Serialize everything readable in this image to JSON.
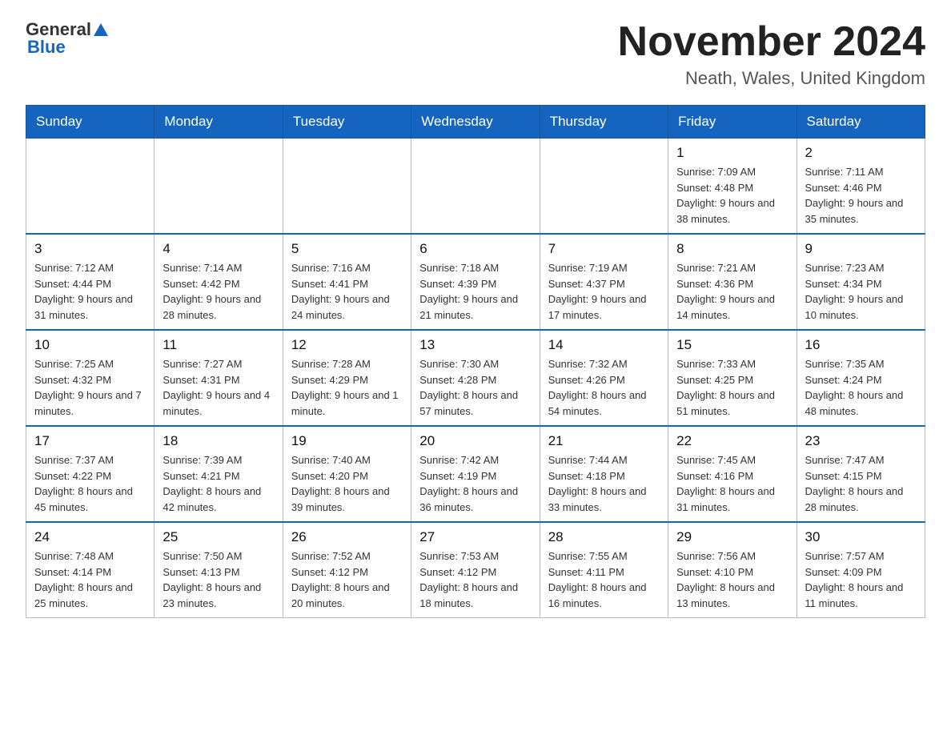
{
  "header": {
    "logo_general": "General",
    "logo_blue": "Blue",
    "month_title": "November 2024",
    "location": "Neath, Wales, United Kingdom"
  },
  "weekdays": [
    "Sunday",
    "Monday",
    "Tuesday",
    "Wednesday",
    "Thursday",
    "Friday",
    "Saturday"
  ],
  "weeks": [
    [
      {
        "day": "",
        "info": ""
      },
      {
        "day": "",
        "info": ""
      },
      {
        "day": "",
        "info": ""
      },
      {
        "day": "",
        "info": ""
      },
      {
        "day": "",
        "info": ""
      },
      {
        "day": "1",
        "info": "Sunrise: 7:09 AM\nSunset: 4:48 PM\nDaylight: 9 hours and 38 minutes."
      },
      {
        "day": "2",
        "info": "Sunrise: 7:11 AM\nSunset: 4:46 PM\nDaylight: 9 hours and 35 minutes."
      }
    ],
    [
      {
        "day": "3",
        "info": "Sunrise: 7:12 AM\nSunset: 4:44 PM\nDaylight: 9 hours and 31 minutes."
      },
      {
        "day": "4",
        "info": "Sunrise: 7:14 AM\nSunset: 4:42 PM\nDaylight: 9 hours and 28 minutes."
      },
      {
        "day": "5",
        "info": "Sunrise: 7:16 AM\nSunset: 4:41 PM\nDaylight: 9 hours and 24 minutes."
      },
      {
        "day": "6",
        "info": "Sunrise: 7:18 AM\nSunset: 4:39 PM\nDaylight: 9 hours and 21 minutes."
      },
      {
        "day": "7",
        "info": "Sunrise: 7:19 AM\nSunset: 4:37 PM\nDaylight: 9 hours and 17 minutes."
      },
      {
        "day": "8",
        "info": "Sunrise: 7:21 AM\nSunset: 4:36 PM\nDaylight: 9 hours and 14 minutes."
      },
      {
        "day": "9",
        "info": "Sunrise: 7:23 AM\nSunset: 4:34 PM\nDaylight: 9 hours and 10 minutes."
      }
    ],
    [
      {
        "day": "10",
        "info": "Sunrise: 7:25 AM\nSunset: 4:32 PM\nDaylight: 9 hours and 7 minutes."
      },
      {
        "day": "11",
        "info": "Sunrise: 7:27 AM\nSunset: 4:31 PM\nDaylight: 9 hours and 4 minutes."
      },
      {
        "day": "12",
        "info": "Sunrise: 7:28 AM\nSunset: 4:29 PM\nDaylight: 9 hours and 1 minute."
      },
      {
        "day": "13",
        "info": "Sunrise: 7:30 AM\nSunset: 4:28 PM\nDaylight: 8 hours and 57 minutes."
      },
      {
        "day": "14",
        "info": "Sunrise: 7:32 AM\nSunset: 4:26 PM\nDaylight: 8 hours and 54 minutes."
      },
      {
        "day": "15",
        "info": "Sunrise: 7:33 AM\nSunset: 4:25 PM\nDaylight: 8 hours and 51 minutes."
      },
      {
        "day": "16",
        "info": "Sunrise: 7:35 AM\nSunset: 4:24 PM\nDaylight: 8 hours and 48 minutes."
      }
    ],
    [
      {
        "day": "17",
        "info": "Sunrise: 7:37 AM\nSunset: 4:22 PM\nDaylight: 8 hours and 45 minutes."
      },
      {
        "day": "18",
        "info": "Sunrise: 7:39 AM\nSunset: 4:21 PM\nDaylight: 8 hours and 42 minutes."
      },
      {
        "day": "19",
        "info": "Sunrise: 7:40 AM\nSunset: 4:20 PM\nDaylight: 8 hours and 39 minutes."
      },
      {
        "day": "20",
        "info": "Sunrise: 7:42 AM\nSunset: 4:19 PM\nDaylight: 8 hours and 36 minutes."
      },
      {
        "day": "21",
        "info": "Sunrise: 7:44 AM\nSunset: 4:18 PM\nDaylight: 8 hours and 33 minutes."
      },
      {
        "day": "22",
        "info": "Sunrise: 7:45 AM\nSunset: 4:16 PM\nDaylight: 8 hours and 31 minutes."
      },
      {
        "day": "23",
        "info": "Sunrise: 7:47 AM\nSunset: 4:15 PM\nDaylight: 8 hours and 28 minutes."
      }
    ],
    [
      {
        "day": "24",
        "info": "Sunrise: 7:48 AM\nSunset: 4:14 PM\nDaylight: 8 hours and 25 minutes."
      },
      {
        "day": "25",
        "info": "Sunrise: 7:50 AM\nSunset: 4:13 PM\nDaylight: 8 hours and 23 minutes."
      },
      {
        "day": "26",
        "info": "Sunrise: 7:52 AM\nSunset: 4:12 PM\nDaylight: 8 hours and 20 minutes."
      },
      {
        "day": "27",
        "info": "Sunrise: 7:53 AM\nSunset: 4:12 PM\nDaylight: 8 hours and 18 minutes."
      },
      {
        "day": "28",
        "info": "Sunrise: 7:55 AM\nSunset: 4:11 PM\nDaylight: 8 hours and 16 minutes."
      },
      {
        "day": "29",
        "info": "Sunrise: 7:56 AM\nSunset: 4:10 PM\nDaylight: 8 hours and 13 minutes."
      },
      {
        "day": "30",
        "info": "Sunrise: 7:57 AM\nSunset: 4:09 PM\nDaylight: 8 hours and 11 minutes."
      }
    ]
  ]
}
